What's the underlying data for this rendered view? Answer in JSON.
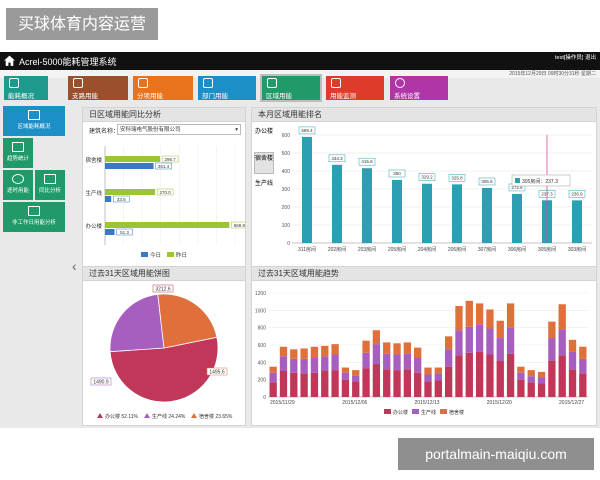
{
  "overlay_title": "买球体育内容运营",
  "watermark": "portalmain-maiqiu.com",
  "header": {
    "system_name": "Acrel-5000能耗管理系统",
    "user": "test[操作员]",
    "exit": "退出",
    "datetime": "2015年12月29日 09时30分31秒 星期二"
  },
  "nav": [
    {
      "label": "能耗概况",
      "color": "#1e9a8c"
    },
    {
      "label": "支路用能",
      "color": "#9b4f2d"
    },
    {
      "label": "分项用能",
      "color": "#e8731c"
    },
    {
      "label": "部门用能",
      "color": "#1d8fc7"
    },
    {
      "label": "区域用能",
      "color": "#1f9a68"
    },
    {
      "label": "用能监测",
      "color": "#de3c2a"
    },
    {
      "label": "系统设置",
      "color": "#b035a7"
    }
  ],
  "sidebar": [
    {
      "label": "区域能耗概况"
    },
    {
      "label": "趋势统计"
    },
    {
      "label": "逐时用能"
    },
    {
      "label": "同比分析"
    },
    {
      "label": "非工作日用能分析"
    }
  ],
  "panels": {
    "compare": {
      "title": "日区域用能同比分析",
      "building_label": "建筑名称：",
      "building_value": "安科瑞电气股份有限公司"
    },
    "ranking": {
      "title": "本月区域用能排名"
    },
    "pie": {
      "title": "过去31天区域用能饼图"
    },
    "trend": {
      "title": "过去31天区域用能趋势"
    }
  },
  "ranking_tabs": [
    "办公楼",
    "宿舍楼",
    "生产线"
  ],
  "colors": {
    "bar_blue": "#3b7ac2",
    "bar_green": "#9cc437",
    "teal": "#2d9fb3",
    "pie_red": "#c0375a",
    "pie_purple": "#a65fbf",
    "pie_orange": "#e0703b"
  },
  "chart_data": [
    {
      "type": "bar",
      "orientation": "horizontal",
      "categories": [
        "宿舍楼",
        "生产线",
        "办公楼"
      ],
      "series": [
        {
          "name": "今日",
          "values": [
            261.4,
            33.5,
            51.3
          ],
          "labels": [
            "261.4",
            "33.5",
            "51.3"
          ]
        },
        {
          "name": "昨日",
          "values": [
            296.7,
            270.0,
            669.9
          ],
          "labels": [
            "296.7",
            "270.0",
            "669.9"
          ]
        }
      ],
      "xlim": [
        0,
        700
      ]
    },
    {
      "type": "bar",
      "categories": [
        "311房间",
        "202房间",
        "203房间",
        "205房间",
        "204房间",
        "206房间",
        "307房间",
        "306房间",
        "305房间",
        "303房间"
      ],
      "values": [
        589.4,
        434.3,
        415.6,
        350.0,
        329.2,
        325.8,
        305.6,
        272.6,
        237.3,
        236.9
      ],
      "labels": [
        "589.4",
        "434.3",
        "415.6",
        "350",
        "329.2",
        "325.8",
        "305.6",
        "272.6",
        "237.3",
        "236.9"
      ],
      "ylim": [
        0,
        600
      ],
      "yticks": [
        0,
        100,
        200,
        300,
        400,
        500,
        600
      ],
      "tooltip": "305房间：237.3"
    },
    {
      "type": "pie",
      "slices": [
        {
          "name": "办公楼",
          "value": 52.11,
          "label": "52.11%"
        },
        {
          "name": "生产线",
          "value": 24.24,
          "label": "24.24%"
        },
        {
          "name": "宿舍楼",
          "value": 23.65,
          "label": "23.65%"
        }
      ],
      "annotations": [
        "3212.6",
        "1490.9",
        "1495.6"
      ]
    },
    {
      "type": "bar",
      "stacked": true,
      "series_names": [
        "办公楼",
        "生产线",
        "宿舍楼"
      ],
      "x_labels": [
        "2015/11/29",
        "2015/12/06",
        "2015/12/13",
        "2015/12/20",
        "2015/12/27"
      ],
      "ylim": [
        0,
        1200
      ],
      "yticks": [
        0,
        200,
        400,
        600,
        800,
        1000,
        1200
      ],
      "series": [
        {
          "name": "办公楼",
          "values": [
            170,
            300,
            280,
            270,
            280,
            300,
            310,
            200,
            180,
            330,
            380,
            320,
            310,
            320,
            280,
            180,
            190,
            350,
            480,
            510,
            520,
            490,
            420,
            500,
            200,
            170,
            160,
            420,
            480,
            320,
            270
          ]
        },
        {
          "name": "生产线",
          "values": [
            110,
            170,
            160,
            170,
            170,
            170,
            180,
            80,
            70,
            180,
            230,
            180,
            180,
            180,
            170,
            80,
            80,
            200,
            290,
            300,
            320,
            300,
            260,
            300,
            80,
            70,
            70,
            260,
            300,
            200,
            170
          ]
        },
        {
          "name": "宿舍楼",
          "values": [
            70,
            110,
            110,
            120,
            130,
            120,
            120,
            60,
            60,
            140,
            160,
            130,
            130,
            130,
            120,
            80,
            70,
            150,
            280,
            300,
            240,
            220,
            200,
            280,
            70,
            70,
            60,
            190,
            290,
            140,
            140
          ]
        }
      ]
    }
  ]
}
